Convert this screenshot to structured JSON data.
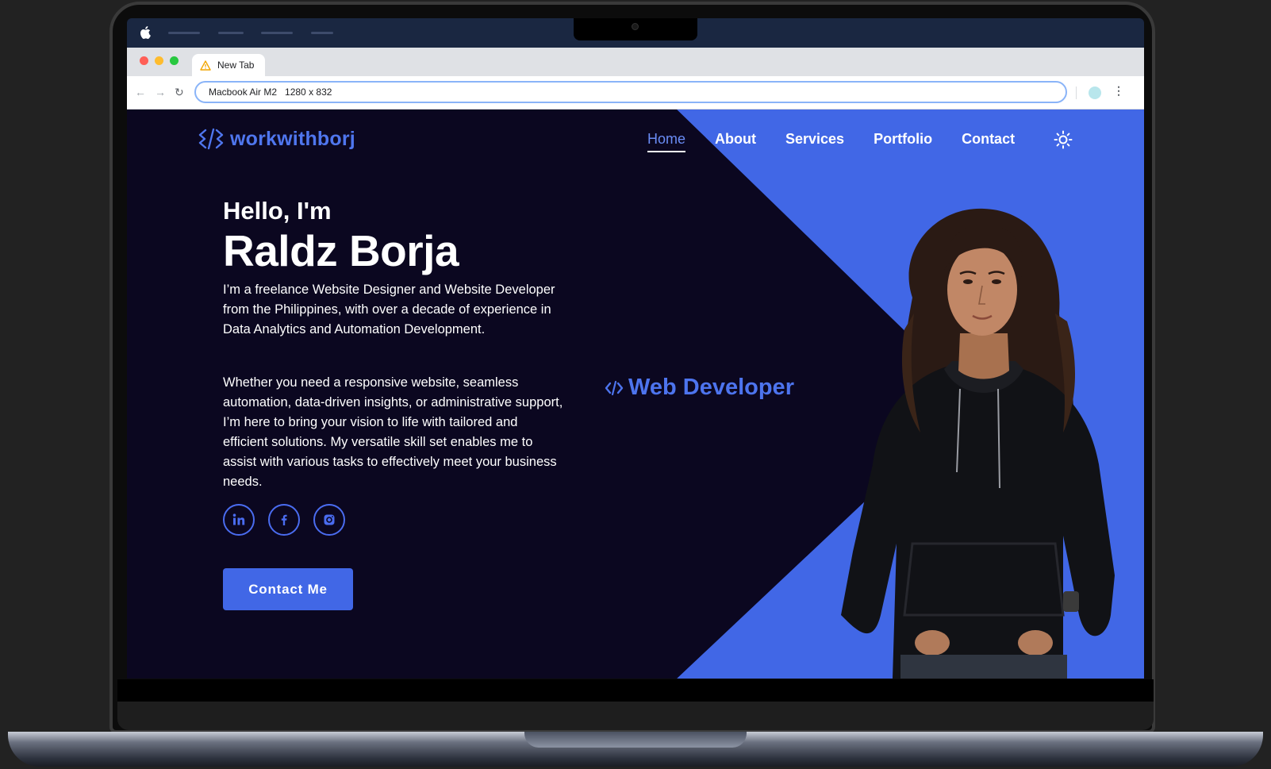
{
  "browser": {
    "tab_title": "New Tab",
    "url": "Macbook Air M2   1280 x 832"
  },
  "site": {
    "logo_text": "workwithborj",
    "nav": {
      "items": [
        {
          "label": "Home",
          "active": true
        },
        {
          "label": "About"
        },
        {
          "label": "Services"
        },
        {
          "label": "Portfolio"
        },
        {
          "label": "Contact"
        }
      ],
      "theme_toggle_icon": "sun-icon"
    },
    "hero": {
      "greeting": "Hello, I'm",
      "name": "Raldz Borja",
      "intro": "I’m a freelance Website Designer and Website Developer from the Philippines, with over a decade of experience in Data Analytics and Automation Development.",
      "pitch": "Whether you need a responsive website, seamless automation, data-driven insights, or administrative support, I’m here to bring your vision to life with tailored and efficient solutions. My versatile skill set enables me to assist with various tasks to effectively meet your business needs.",
      "socials": [
        "linkedin-icon",
        "facebook-icon",
        "instagram-icon"
      ],
      "cta_label": "Contact Me",
      "role": "Web Developer"
    }
  },
  "colors": {
    "accent": "#4167e6",
    "background": "#0b0720",
    "menubar": "#1a2741"
  }
}
